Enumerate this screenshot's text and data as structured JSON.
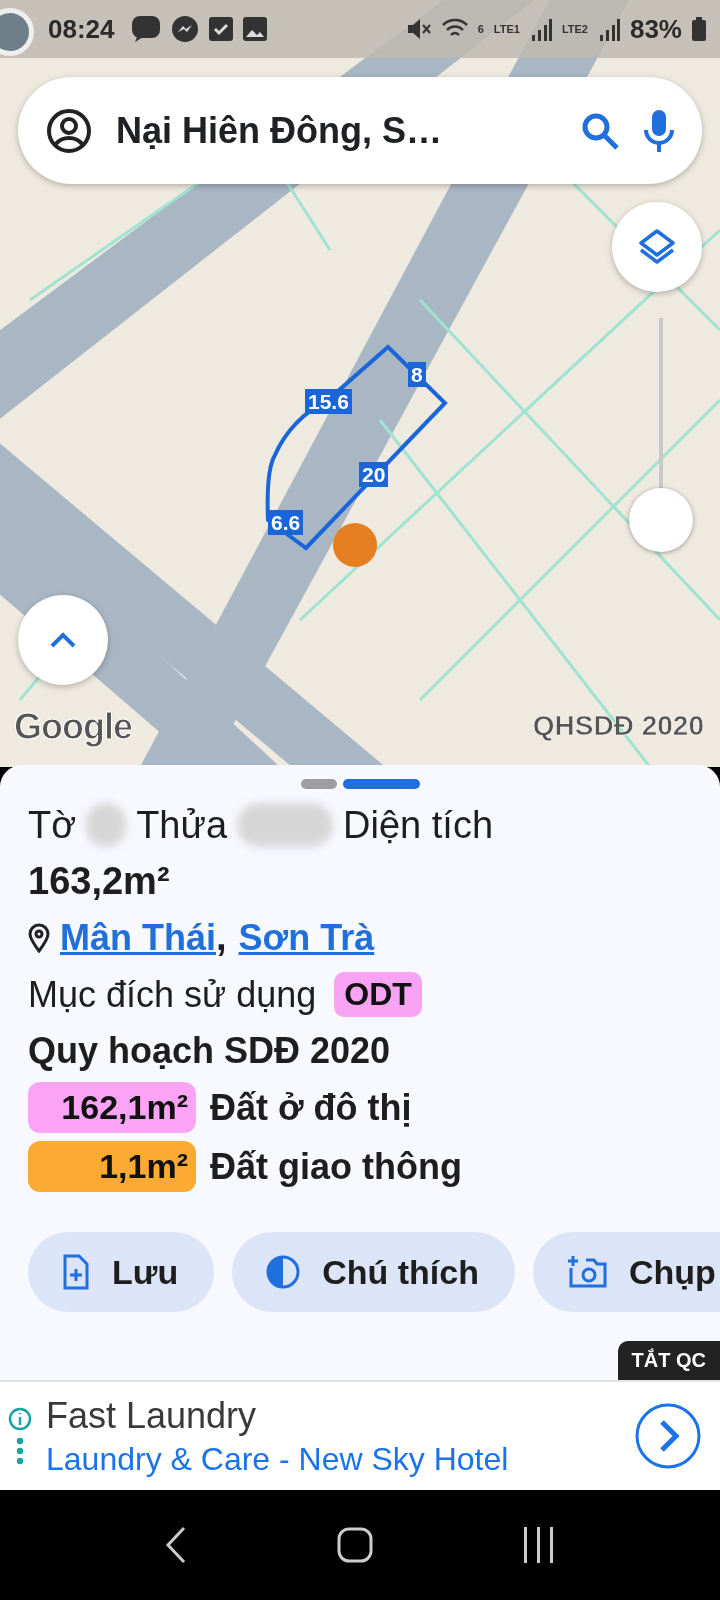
{
  "status_bar": {
    "time": "08:24",
    "wifi_label": "6",
    "sim_labels": [
      "LTE1",
      "LTE2"
    ],
    "battery": "83%"
  },
  "search": {
    "value": "Nại Hiên Đông, S…"
  },
  "map": {
    "kind": "picture",
    "parcel_edges": [
      "15.6",
      "8",
      "20",
      "6.6"
    ],
    "attribution": "Google",
    "layer_label": "QHSDĐ 2020",
    "zoom_slider": {
      "level": 0
    }
  },
  "sheet": {
    "pages": [
      {
        "selected": false
      },
      {
        "selected": true
      }
    ],
    "title_parts": [
      "Tờ",
      "Thửa",
      "Diện tích"
    ],
    "area": "163,2m²",
    "location": [
      {
        "label": "Mân Thái"
      },
      {
        "label": "Sơn Trà"
      }
    ],
    "separator": ",",
    "usage_label": "Mục đích sử dụng",
    "usage_code": {
      "label": "ODT",
      "color": "#f9a3f4"
    },
    "plan_title": "Quy hoạch SDĐ 2020",
    "plan_rows": [
      {
        "area": "162,1m²",
        "label": "Đất ở đô thị",
        "color": "#fba4f5"
      },
      {
        "area": "1,1m²",
        "label": "Đất giao thông",
        "color": "#fbab33"
      }
    ],
    "actions": [
      {
        "kind": "save",
        "label": "Lưu"
      },
      {
        "kind": "legend",
        "label": "Chú thích"
      },
      {
        "kind": "capture",
        "label": "Chụp"
      }
    ]
  },
  "ad": {
    "close_label": "TẮT QC",
    "title": "Fast Laundry",
    "subtitle": "Laundry & Care - New Sky Hotel"
  }
}
